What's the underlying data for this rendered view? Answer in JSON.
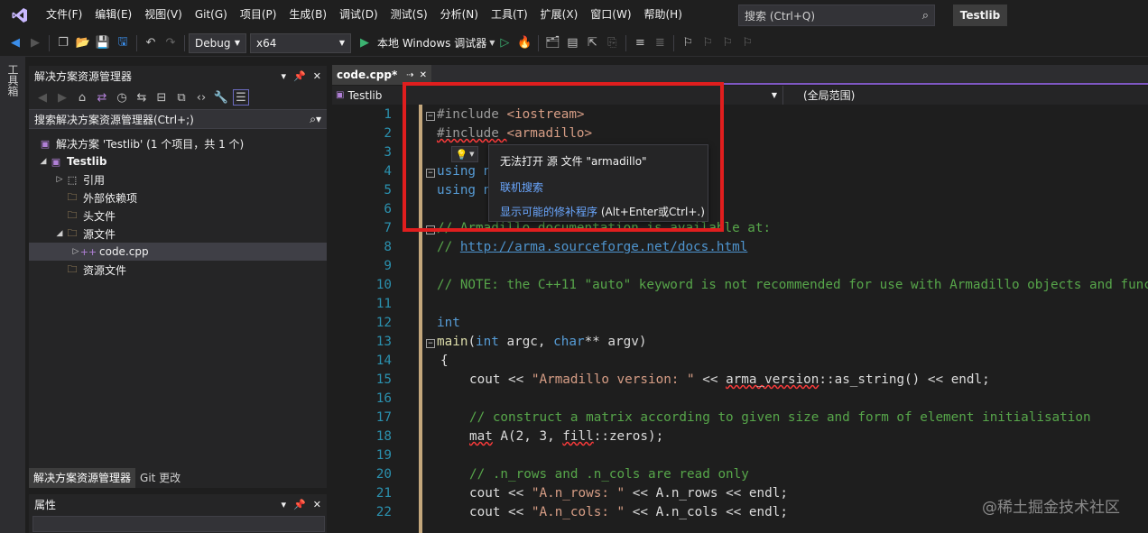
{
  "menubar": {
    "items": [
      "文件(F)",
      "编辑(E)",
      "视图(V)",
      "Git(G)",
      "项目(P)",
      "生成(B)",
      "调试(D)",
      "测试(S)",
      "分析(N)",
      "工具(T)",
      "扩展(X)",
      "窗口(W)",
      "帮助(H)"
    ],
    "search_placeholder": "搜索 (Ctrl+Q)",
    "solution_badge": "Testlib"
  },
  "toolbar": {
    "config": "Debug",
    "platform": "x64",
    "run_label": "本地 Windows 调试器"
  },
  "toolbox": {
    "label": "工具箱"
  },
  "solution_explorer": {
    "title": "解决方案资源管理器",
    "search_placeholder": "搜索解决方案资源管理器(Ctrl+;)",
    "tree": [
      {
        "label": "解决方案 'Testlib' (1 个项目，共 1 个)",
        "icon": "solution-icon"
      },
      {
        "label": "Testlib",
        "icon": "project-icon"
      },
      {
        "label": "引用",
        "icon": "references-icon"
      },
      {
        "label": "外部依赖项",
        "icon": "external-deps-icon"
      },
      {
        "label": "头文件",
        "icon": "folder-icon"
      },
      {
        "label": "源文件",
        "icon": "folder-icon"
      },
      {
        "label": "code.cpp",
        "icon": "cpp-file-icon"
      },
      {
        "label": "资源文件",
        "icon": "folder-icon"
      }
    ],
    "tabs": [
      "解决方案资源管理器",
      "Git 更改"
    ]
  },
  "properties": {
    "title": "属性"
  },
  "editor": {
    "tab_label": "code.cpp*",
    "nav_project": "Testlib",
    "nav_scope": "(全局范围)",
    "lines": [
      "1",
      "2",
      "3",
      "4",
      "5",
      "6",
      "7",
      "8",
      "9",
      "10",
      "11",
      "12",
      "13",
      "14",
      "15",
      "16",
      "17",
      "18",
      "19",
      "20",
      "21",
      "22"
    ],
    "code": {
      "l1_pp": "#include ",
      "l1_rest": "<iostream>",
      "l2_pp": "#include ",
      "l2_rest": "<armadillo>",
      "l4": "using n",
      "l5": "using n",
      "l7": "// Armadillo documentation is available at:",
      "l8_cm": "// ",
      "l8_url": "http://arma.sourceforge.net/docs.html",
      "l10": "// NOTE: the C++11 \"auto\" keyword is not recommended for use with Armadillo objects and func",
      "l12": "int",
      "l13_fn": "main",
      "l13_rest1": "(",
      "l13_kw1": "int",
      "l13_rest2": " argc, ",
      "l13_kw2": "char",
      "l13_rest3": "** argv)",
      "l14": "{",
      "l15_a": "cout << ",
      "l15_str": "\"Armadillo version: \"",
      "l15_b": " << ",
      "l15_sq": "arma_version",
      "l15_c": "::as_string() << endl;",
      "l17": "// construct a matrix according to given size and form of element initialisation",
      "l18_sq": "mat",
      "l18_b": " A(2, 3, ",
      "l18_sq2": "fill",
      "l18_c": "::zeros);",
      "l20": "// .n_rows and .n_cols are read only",
      "l21_a": "cout << ",
      "l21_str": "\"A.n_rows: \"",
      "l21_b": " << A.n_rows << endl;",
      "l22_a": "cout << ",
      "l22_str": "\"A.n_cols: \"",
      "l22_b": " << A.n_cols << endl;"
    }
  },
  "quick_actions": {
    "title": "无法打开 源 文件 \"armadillo\"",
    "search_online": "联机搜索",
    "show_fixes": "显示可能的修补程序",
    "show_fixes_hint": " (Alt+Enter或Ctrl+.)"
  },
  "watermark": "@稀土掘金技术社区",
  "colors": {
    "accent": "#7e57c2",
    "highlight": "#e01e1e"
  }
}
